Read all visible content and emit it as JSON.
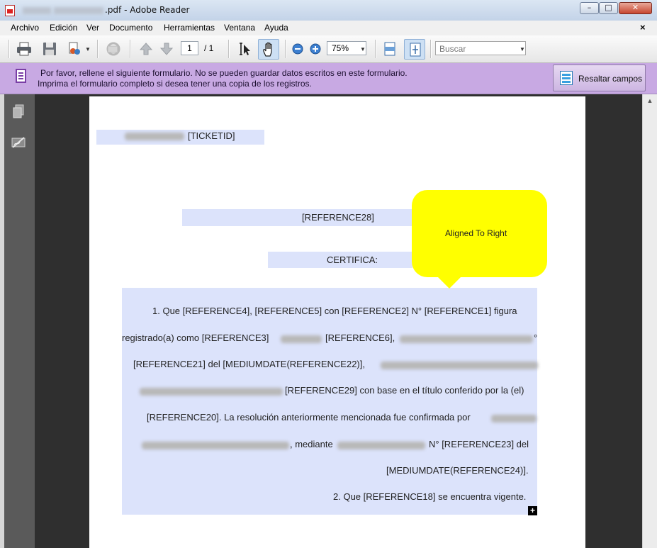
{
  "window": {
    "title_suffix": ".pdf - Adobe Reader",
    "buttons": {
      "minimize": "–",
      "maximize": "□",
      "close": "✕"
    }
  },
  "menu": {
    "items": [
      "Archivo",
      "Edición",
      "Ver",
      "Documento",
      "Herramientas",
      "Ventana",
      "Ayuda"
    ],
    "close_glyph": "×"
  },
  "toolbar": {
    "page_current": "1",
    "page_total": "/ 1",
    "zoom": "75%",
    "search_placeholder": "Buscar",
    "icons": [
      "print-icon",
      "save-icon",
      "collaborate-icon",
      "email-icon",
      "previous-page-icon",
      "next-page-icon",
      "select-text-icon",
      "hand-tool-icon",
      "zoom-out-icon",
      "zoom-in-icon",
      "fit-width-icon",
      "fit-page-icon"
    ]
  },
  "form_bar": {
    "message_line1": "Por favor, rellene el siguiente formulario. No se pueden guardar datos escritos en este formulario.",
    "message_line2": "Imprima el formulario completo si desea tener una copia de los registros.",
    "highlight_button": "Resaltar campos",
    "background": "#c8a9e3"
  },
  "document": {
    "ticket_field": "[TICKETID]",
    "reference28": "[REFERENCE28]",
    "certifica": "CERTIFICA:",
    "body": {
      "line1": "1. Que [REFERENCE4], [REFERENCE5] con [REFERENCE2] N° [REFERENCE1] figura",
      "line2a": "registrado(a) como [REFERENCE3]",
      "line2b": "[REFERENCE6],",
      "line2c": "°",
      "line3": "[REFERENCE21] del [MEDIUMDATE(REFERENCE22)],",
      "line4": "[REFERENCE29] con base en el título conferido por la (el)",
      "line5": "[REFERENCE20]. La resolución anteriormente mencionada fue confirmada por",
      "line6a": ", mediante",
      "line6b": "N°  [REFERENCE23] del",
      "line7": "[MEDIUMDATE(REFERENCE24)].",
      "line8": "2. Que [REFERENCE18] se encuentra vigente."
    },
    "expand_glyph": "+",
    "field_color": "#dce3fb"
  },
  "callout": {
    "text": "Aligned To Right",
    "color": "#ffff00"
  }
}
